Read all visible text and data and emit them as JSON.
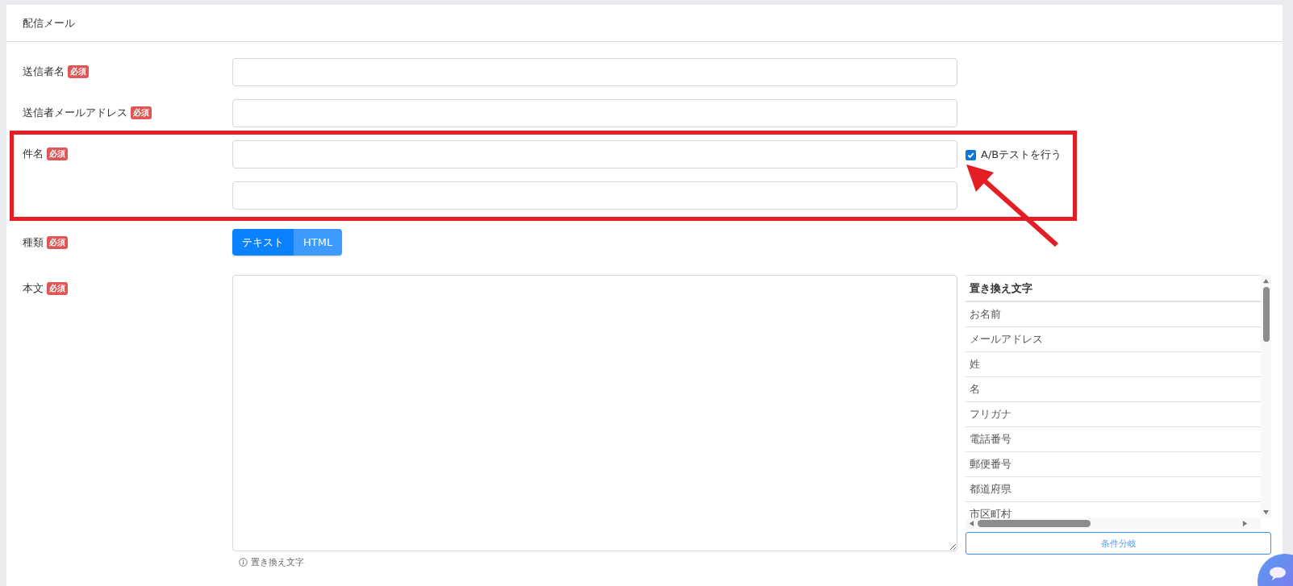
{
  "card": {
    "title": "配信メール"
  },
  "sender_name": {
    "label": "送信者名",
    "badge": "必須"
  },
  "sender_address": {
    "label": "送信者メールアドレス",
    "badge": "必須"
  },
  "subject": {
    "label": "件名",
    "badge": "必須",
    "ab_test": {
      "label": "A/Bテストを行う",
      "checked": true
    }
  },
  "type": {
    "label": "種類",
    "badge": "必須",
    "options": [
      {
        "label": "テキスト",
        "selected": true
      },
      {
        "label": "HTML",
        "selected": false
      }
    ]
  },
  "body": {
    "label": "本文",
    "badge": "必須",
    "hint": "置き換え文字"
  },
  "replacement_table": {
    "header": "置き換え文字",
    "rows": [
      "お名前",
      "メールアドレス",
      "姓",
      "名",
      "フリガナ",
      "電話番号",
      "郵便番号",
      "都道府県",
      "市区町村"
    ]
  },
  "condition_button": "条件分岐"
}
